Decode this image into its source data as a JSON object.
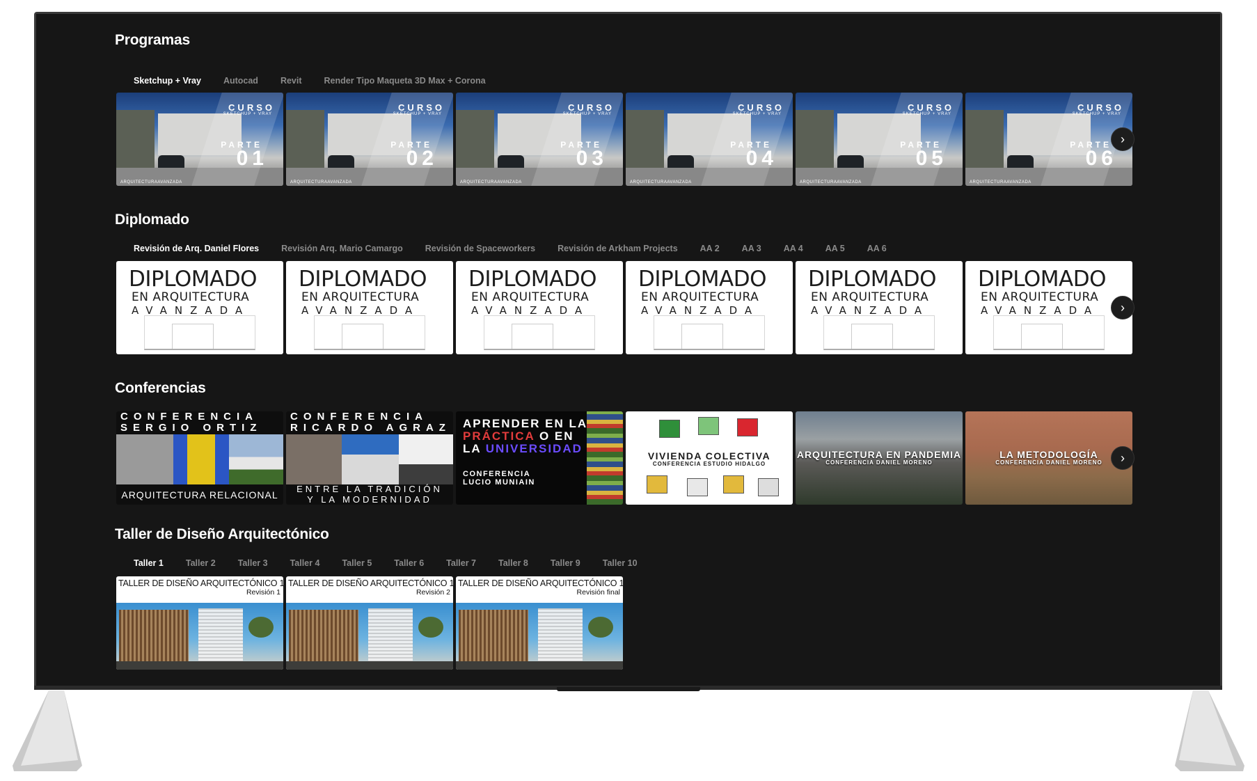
{
  "sections": {
    "programas": {
      "title": "Programas",
      "tabs": [
        "Sketchup + Vray",
        "Autocad",
        "Revit",
        "Render Tipo Maqueta 3D Max + Corona"
      ],
      "cards": [
        {
          "curso": "CURSO",
          "sub": "SKETCHUP + VRAY",
          "parte": "PARTE",
          "num": "01",
          "foot": "ARQUITECTURAAVANZADA"
        },
        {
          "curso": "CURSO",
          "sub": "SKETCHUP + VRAY",
          "parte": "PARTE",
          "num": "02",
          "foot": "ARQUITECTURAAVANZADA"
        },
        {
          "curso": "CURSO",
          "sub": "SKETCHUP + VRAY",
          "parte": "PARTE",
          "num": "03",
          "foot": "ARQUITECTURAAVANZADA"
        },
        {
          "curso": "CURSO",
          "sub": "SKETCHUP + VRAY",
          "parte": "PARTE",
          "num": "04",
          "foot": "ARQUITECTURAAVANZADA"
        },
        {
          "curso": "CURSO",
          "sub": "SKETCHUP + VRAY",
          "parte": "PARTE",
          "num": "05",
          "foot": "ARQUITECTURAAVANZADA"
        },
        {
          "curso": "CURSO",
          "sub": "SKETCHUP + VRAY",
          "parte": "PARTE",
          "num": "06",
          "foot": "ARQUITECTURAAVANZADA"
        }
      ]
    },
    "diplomado": {
      "title": "Diplomado",
      "tabs": [
        "Revisión de Arq. Daniel Flores",
        "Revisión Arq. Mario Camargo",
        "Revisión de Spaceworkers",
        "Revisión de Arkham Projects",
        "AA 2",
        "AA 3",
        "AA 4",
        "AA 5",
        "AA 6"
      ],
      "card": {
        "t1": "DIPLOMADO",
        "t2": "EN ARQUITECTURA",
        "t3": "AVANZADA"
      }
    },
    "conferencias": {
      "title": "Conferencias",
      "c1": {
        "l1": "CONFERENCIA",
        "l2": "SERGIO ORTIZ",
        "bottom": "ARQUITECTURA RELACIONAL"
      },
      "c2": {
        "l1": "CONFERENCIA",
        "l2": "RICARDO AGRAZ",
        "b1": "ENTRE LA TRADICIÓN",
        "b2": "Y LA MODERNIDAD"
      },
      "c3": {
        "w1": "APRENDER EN LA",
        "w2a": "PRÁCTICA",
        "w2b": "O EN",
        "w3a": "LA",
        "w3b": "UNIVERSIDAD",
        "s1": "CONFERENCIA",
        "s2": "LUCIO MUNIAIN"
      },
      "c4": {
        "t": "VIVIENDA COLECTIVA",
        "s": "CONFERENCIA ESTUDIO HIDALGO"
      },
      "c5": {
        "t": "ARQUITECTURA EN PANDEMIA",
        "s": "CONFERENCIA DANIEL MORENO"
      },
      "c6": {
        "t": "LA METODOLOGÍA",
        "s": "CONFERENCIA DANIEL MORENO"
      }
    },
    "taller": {
      "title": "Taller de Diseño Arquitectónico",
      "tabs": [
        "Taller 1",
        "Taller 2",
        "Taller 3",
        "Taller 4",
        "Taller 5",
        "Taller 6",
        "Taller 7",
        "Taller 8",
        "Taller 9",
        "Taller 10"
      ],
      "cards": [
        {
          "h1": "TALLER DE DISEÑO ARQUITECTÓNICO 1",
          "h2": "Revisión 1"
        },
        {
          "h1": "TALLER DE DISEÑO ARQUITECTÓNICO 1",
          "h2": "Revisión 2"
        },
        {
          "h1": "TALLER DE DISEÑO ARQUITECTÓNICO 1",
          "h2": "Revisión final"
        }
      ]
    }
  },
  "icons": {
    "next": "chevron-right-icon"
  },
  "colors": {
    "background": "#161616",
    "accent_red": "#e23c3c",
    "accent_purple": "#6b4cff"
  }
}
